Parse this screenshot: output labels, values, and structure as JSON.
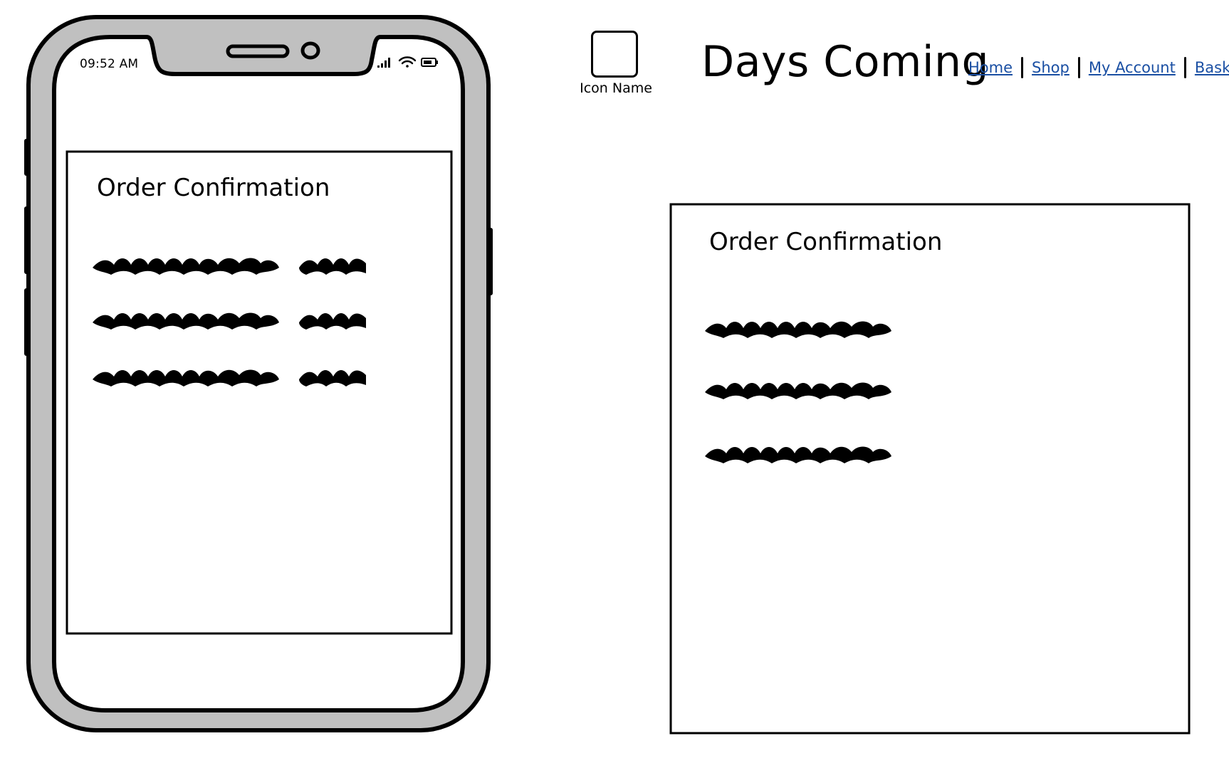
{
  "phone": {
    "status_time": "09:52 AM",
    "card_title": "Order Confirmation",
    "text_rows": 3
  },
  "desktop": {
    "logo_label": "Icon Name",
    "site_title": "Days Coming",
    "nav": [
      "Home",
      "Shop",
      "My Account",
      "Basket"
    ],
    "card_title": "Order Confirmation",
    "text_rows": 3
  },
  "colors": {
    "phone_frame": "#c0c0c0",
    "link": "#1a4fa3",
    "ink": "#000000"
  }
}
